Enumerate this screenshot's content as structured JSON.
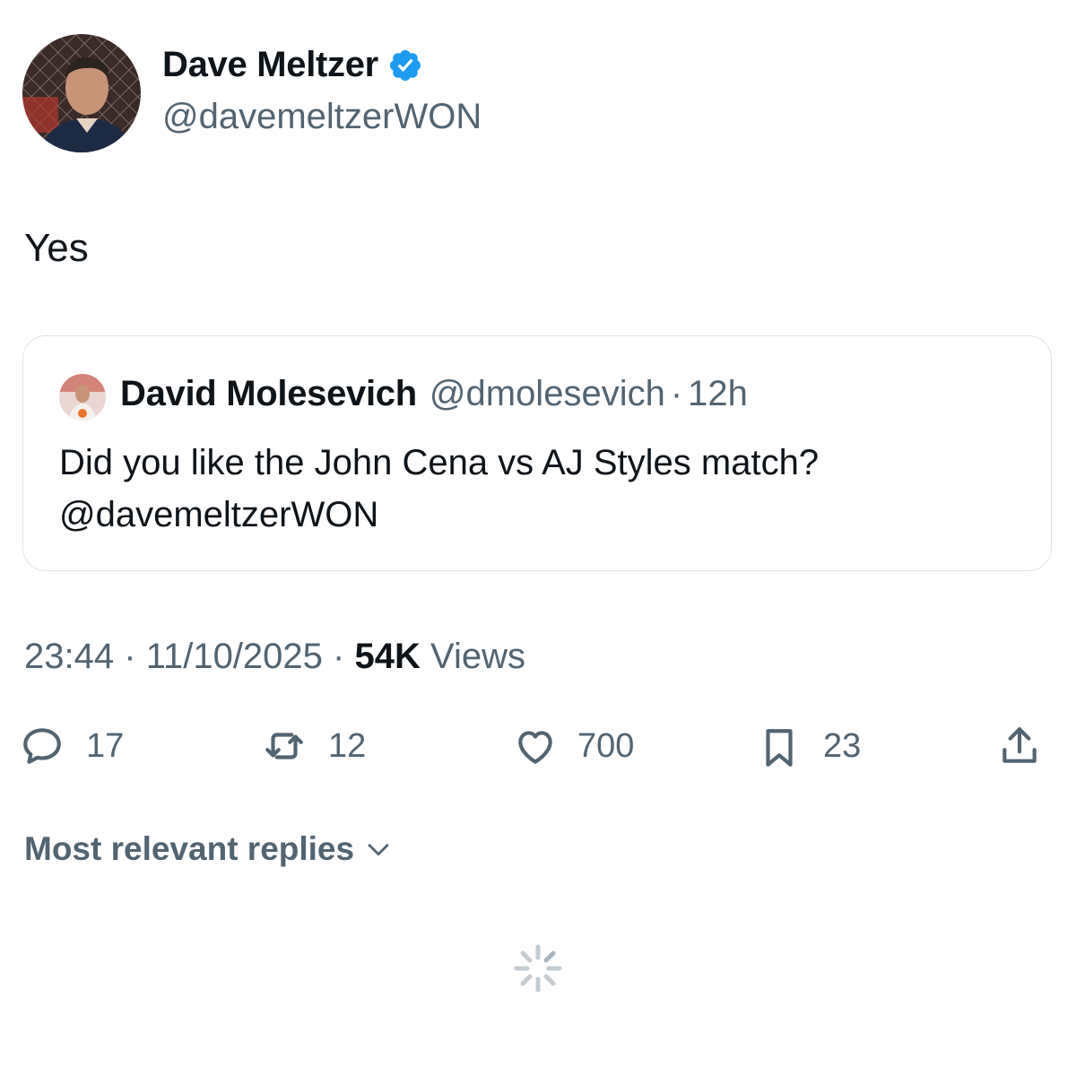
{
  "tweet": {
    "author": {
      "name": "Dave Meltzer",
      "handle": "@davemeltzerWON",
      "verified_icon": "verified-badge-icon",
      "avatar_icon": "profile-photo"
    },
    "text": "Yes",
    "quote": {
      "author_name": "David Molesevich",
      "author_handle": "@dmolesevich",
      "separator": "·",
      "time": "12h",
      "text": "Did you like the John Cena vs AJ Styles match? @davemeltzerWON",
      "avatar_icon": "profile-photo"
    },
    "meta": {
      "time": "23:44",
      "sep1": "·",
      "date": "11/10/2025",
      "sep2": "·",
      "views_count": "54K",
      "views_label": "Views"
    },
    "actions": {
      "replies": "17",
      "reposts": "12",
      "likes": "700",
      "bookmarks": "23"
    }
  },
  "replies": {
    "sort_label": "Most relevant replies"
  },
  "colors": {
    "primary_text": "#0f1419",
    "secondary_text": "#536471",
    "verified": "#1d9bf0",
    "border": "#dfe3e7"
  }
}
